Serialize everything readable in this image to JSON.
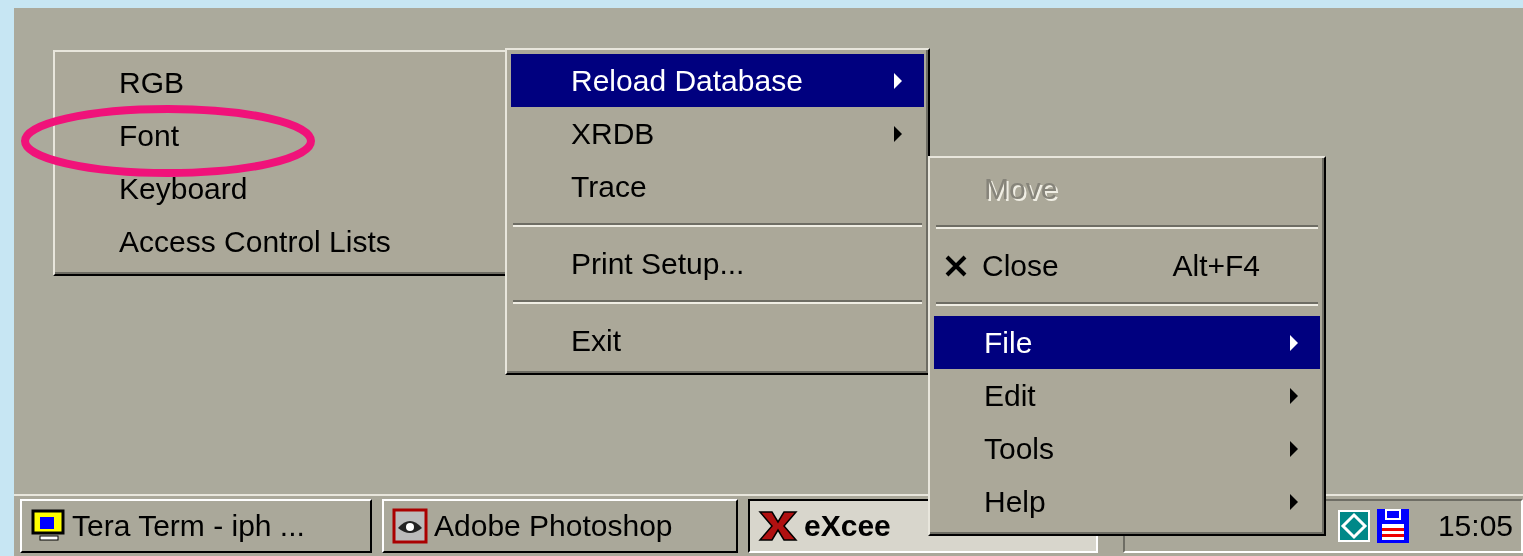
{
  "menus": [
    {
      "items": [
        {
          "kind": "item",
          "label": "RGB",
          "selected": false,
          "disabled": false,
          "submenu": false
        },
        {
          "kind": "item",
          "label": "Font",
          "selected": false,
          "disabled": false,
          "submenu": false
        },
        {
          "kind": "item",
          "label": "Keyboard",
          "selected": false,
          "disabled": false,
          "submenu": false
        },
        {
          "kind": "item",
          "label": "Access Control Lists",
          "selected": false,
          "disabled": false,
          "submenu": false
        }
      ]
    },
    {
      "items": [
        {
          "kind": "item",
          "label": "Reload Database",
          "selected": true,
          "disabled": false,
          "submenu": true
        },
        {
          "kind": "item",
          "label": "XRDB",
          "selected": false,
          "disabled": false,
          "submenu": true
        },
        {
          "kind": "item",
          "label": "Trace",
          "selected": false,
          "disabled": false,
          "submenu": false
        },
        {
          "kind": "separator"
        },
        {
          "kind": "item",
          "label": "Print Setup...",
          "selected": false,
          "disabled": false,
          "submenu": false
        },
        {
          "kind": "separator"
        },
        {
          "kind": "item",
          "label": "Exit",
          "selected": false,
          "disabled": false,
          "submenu": false
        }
      ]
    },
    {
      "items": [
        {
          "kind": "item",
          "label": "Move",
          "selected": false,
          "disabled": true,
          "submenu": false
        },
        {
          "kind": "separator"
        },
        {
          "kind": "item",
          "label": "Close",
          "shortcut": "Alt+F4",
          "selected": false,
          "disabled": false,
          "submenu": false
        },
        {
          "kind": "separator"
        },
        {
          "kind": "item",
          "label": "File",
          "selected": true,
          "disabled": false,
          "submenu": true
        },
        {
          "kind": "item",
          "label": "Edit",
          "selected": false,
          "disabled": false,
          "submenu": true
        },
        {
          "kind": "item",
          "label": "Tools",
          "selected": false,
          "disabled": false,
          "submenu": true
        },
        {
          "kind": "item",
          "label": "Help",
          "selected": false,
          "disabled": false,
          "submenu": true
        }
      ]
    }
  ],
  "annotation": {
    "kind": "ellipse",
    "color": "#f0127a"
  },
  "taskbar": {
    "buttons": [
      {
        "label": "Tera Term - iph ...",
        "selected": false
      },
      {
        "label": "Adobe Photoshop",
        "selected": false
      },
      {
        "label": "eXcee",
        "selected": true
      }
    ],
    "clock": "15:05"
  }
}
